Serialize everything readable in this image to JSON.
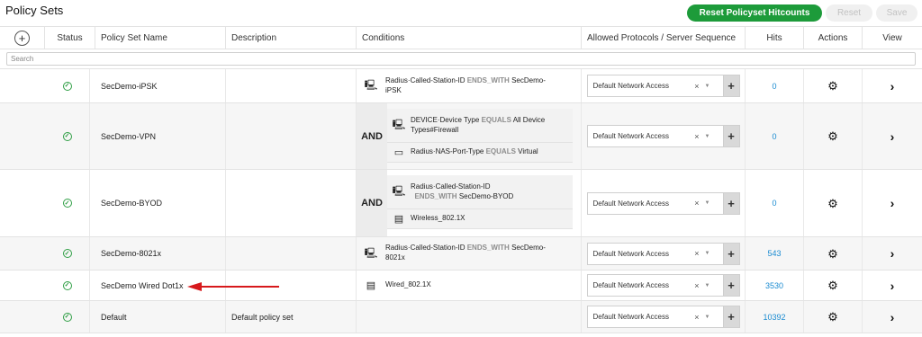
{
  "page": {
    "title": "Policy Sets"
  },
  "toolbar": {
    "reset_hitcounts": "Reset Policyset Hitcounts",
    "reset": "Reset",
    "save": "Save"
  },
  "columns": {
    "add": "+",
    "status": "Status",
    "name": "Policy Set Name",
    "description": "Description",
    "conditions": "Conditions",
    "protocols": "Allowed Protocols / Server Sequence",
    "hits": "Hits",
    "actions": "Actions",
    "view": "View"
  },
  "search": {
    "placeholder": "Search",
    "value": ""
  },
  "icons": {
    "status": "check-circle-icon",
    "actions": "gear-icon",
    "view": "chevron-right-icon",
    "device": "monitor-icon",
    "wireless": "identity-card-icon",
    "nas": "network-port-icon"
  },
  "colors": {
    "accent_green": "#1d9b3a",
    "status_green": "#2e9e44",
    "hits_link": "#1a8bd1",
    "arrow_red": "#d7191c"
  },
  "rows": [
    {
      "name": "SecDemo-iPSK",
      "description": "",
      "condition": {
        "attr": "Radius·Called-Station-ID",
        "op": "ENDS_WITH",
        "val_a": "SecDemo-",
        "val_b": "iPSK"
      },
      "protocol": "Default Network Access",
      "hits": "0"
    },
    {
      "name": "SecDemo-VPN",
      "description": "",
      "and_label": "AND",
      "conditions": [
        {
          "line1_a": "DEVICE·Device Type",
          "op": "EQUALS",
          "line1_b": "All Device",
          "line2": "Types#Firewall"
        },
        {
          "attr": "Radius·NAS-Port-Type",
          "op": "EQUALS",
          "val": "Virtual"
        }
      ],
      "protocol": "Default Network Access",
      "hits": "0"
    },
    {
      "name": "SecDemo-BYOD",
      "description": "",
      "and_label": "AND",
      "conditions": [
        {
          "line1": "Radius·Called-Station-ID",
          "op": "ENDS_WITH",
          "val": "SecDemo-BYOD"
        },
        {
          "text": "Wireless_802.1X"
        }
      ],
      "protocol": "Default Network Access",
      "hits": "0"
    },
    {
      "name": "SecDemo-8021x",
      "description": "",
      "condition": {
        "attr": "Radius·Called-Station-ID",
        "op": "ENDS_WITH",
        "val_a": "SecDemo-",
        "val_b": "8021x"
      },
      "protocol": "Default Network Access",
      "hits": "543"
    },
    {
      "name": "SecDemo Wired Dot1x",
      "description": "",
      "condition": {
        "text": "Wired_802.1X"
      },
      "protocol": "Default Network Access",
      "hits": "3530"
    },
    {
      "name": "Default",
      "description": "Default policy set",
      "protocol": "Default Network Access",
      "hits": "10392"
    }
  ],
  "select_clear": "×",
  "select_caret": "▼",
  "select_add": "+"
}
